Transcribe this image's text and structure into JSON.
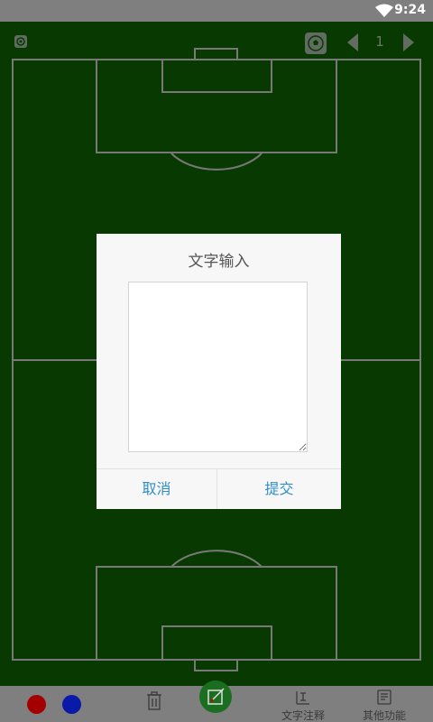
{
  "status_bar": {
    "time": "9:24",
    "wifi_icon": "wifi-icon"
  },
  "top_toolbar": {
    "settings_icon": "gear-icon",
    "ball_icon": "soccer-ball-icon",
    "prev_icon": "triangle-left-icon",
    "page_number": "1",
    "next_icon": "triangle-right-icon"
  },
  "dialog": {
    "title": "文字输入",
    "textarea_value": "",
    "cancel_label": "取消",
    "submit_label": "提交"
  },
  "bottom_bar": {
    "colors": {
      "red": "#a50000",
      "blue": "#0a1aa8"
    },
    "delete_icon": "trash-icon",
    "draw_icon": "pen-square-icon",
    "text_note_label": "文字注释",
    "other_label": "其他功能"
  },
  "colors": {
    "field": "#0b4a00",
    "accent": "#2f8ec9",
    "bars": "#7f7f7f"
  }
}
